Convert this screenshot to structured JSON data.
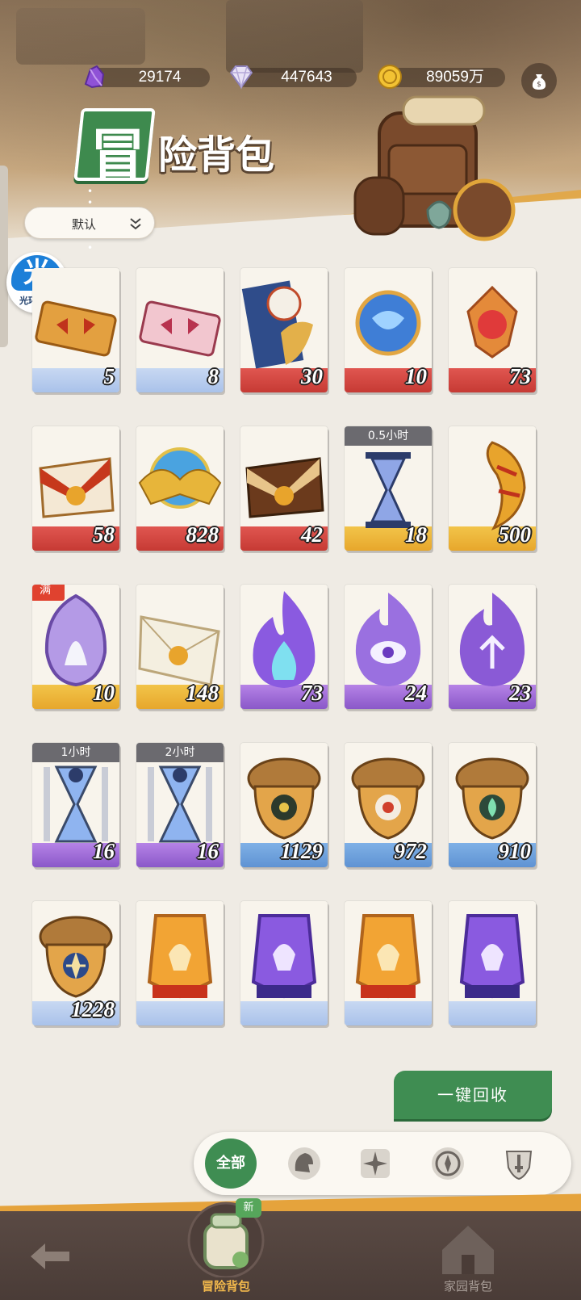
{
  "currency": {
    "crystal": "29174",
    "diamond": "447643",
    "gold": "89059万"
  },
  "title": {
    "badge_char": "冒",
    "rest": "险背包",
    "dots": "• • • • • •"
  },
  "sort": {
    "label": "默认"
  },
  "helper": {
    "char": "光",
    "caption": "光环助手"
  },
  "items": [
    {
      "count": "5",
      "band": "white"
    },
    {
      "count": "8",
      "band": "white"
    },
    {
      "count": "30",
      "band": "red"
    },
    {
      "count": "10",
      "band": "red"
    },
    {
      "count": "73",
      "band": "red"
    },
    {
      "count": "58",
      "band": "red"
    },
    {
      "count": "828",
      "band": "red"
    },
    {
      "count": "42",
      "band": "red"
    },
    {
      "count": "18",
      "band": "gold",
      "timer": "0.5小时"
    },
    {
      "count": "500",
      "band": "gold"
    },
    {
      "count": "10",
      "band": "gold",
      "full": "满"
    },
    {
      "count": "148",
      "band": "gold"
    },
    {
      "count": "73",
      "band": "purple"
    },
    {
      "count": "24",
      "band": "purple"
    },
    {
      "count": "23",
      "band": "purple"
    },
    {
      "count": "16",
      "band": "purple",
      "timer": "1小时"
    },
    {
      "count": "16",
      "band": "purple",
      "timer": "2小时"
    },
    {
      "count": "1129",
      "band": "blue"
    },
    {
      "count": "972",
      "band": "blue"
    },
    {
      "count": "910",
      "band": "blue"
    },
    {
      "count": "1228",
      "band": "white"
    },
    {
      "count": "",
      "band": "white"
    },
    {
      "count": "",
      "band": "white"
    },
    {
      "count": "",
      "band": "white"
    },
    {
      "count": "",
      "band": "white"
    }
  ],
  "recycle_label": "一键回收",
  "filter": {
    "all_label": "全部"
  },
  "nav": {
    "adventure_label": "冒险背包",
    "new_badge": "新",
    "home_label": "家园背包"
  }
}
